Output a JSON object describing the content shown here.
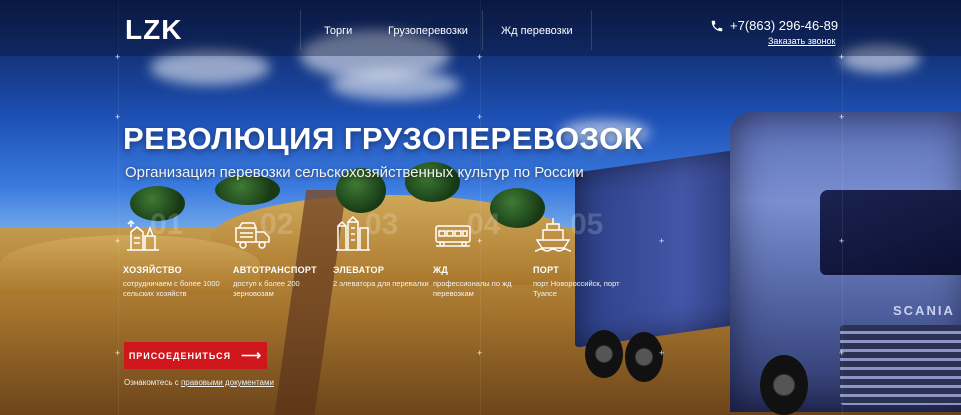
{
  "header": {
    "logo": "LZK",
    "nav": [
      "Торги",
      "Грузоперевозки",
      "Жд перевозки"
    ],
    "phone": "+7(863) 296-46-89",
    "callback_label": "Заказать звонок"
  },
  "hero": {
    "title": "РЕВОЛЮЦИЯ ГРУЗОПЕРЕВОЗОК",
    "subtitle": "Организация перевозки сельскохозяйственных культур по России"
  },
  "numbers": [
    "01",
    "02",
    "03",
    "04",
    "05"
  ],
  "features": [
    {
      "icon": "farm-icon",
      "title": "ХОЗЯЙСТВО",
      "desc": "сотрудничаем с более 1000 сельских хозяйств"
    },
    {
      "icon": "truck-icon",
      "title": "АВТОТРАНСПОРТ",
      "desc": "доступ к более 200 зерновозам"
    },
    {
      "icon": "elevator-icon",
      "title": "ЭЛЕВАТОР",
      "desc": "2 элеватора для перевалки"
    },
    {
      "icon": "train-icon",
      "title": "ЖД",
      "desc": "профессионалы по жд перевозкам"
    },
    {
      "icon": "ship-icon",
      "title": "ПОРТ",
      "desc": "порт Новороссийск, порт Туапсе"
    }
  ],
  "cta": {
    "join_label": "ПРИСОЕДЕНИТЬСЯ",
    "arrow": "⟶",
    "docs_prefix": "Ознакомтесь с ",
    "docs_link": "правовыми документами"
  },
  "colors": {
    "accent": "#d0161d",
    "sky": "#1d4fb3"
  }
}
